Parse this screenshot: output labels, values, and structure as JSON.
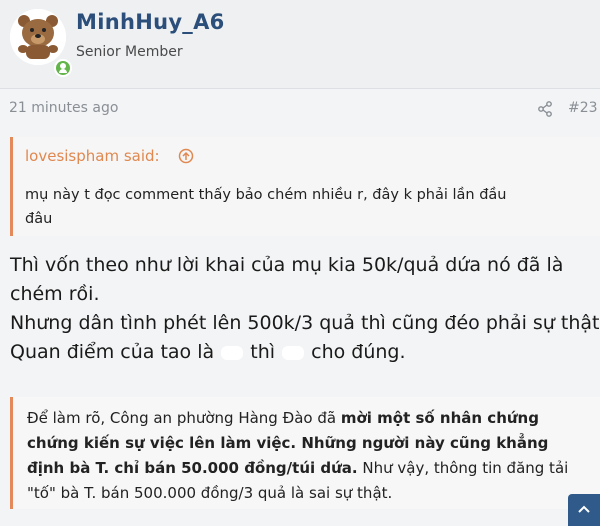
{
  "post": {
    "author": {
      "username": "MinhHuy_A6",
      "title": "Senior Member",
      "avatar_icon": "bear-avatar-icon",
      "online_icon": "online-status-icon"
    },
    "time": "21 minutes ago",
    "share_icon": "share-icon",
    "number": "#23",
    "quote": {
      "author_label": "lovesispham said:",
      "jump_icon": "arrow-up-circle-icon",
      "lines": [
        "mụ này t đọc comment thấy bảo chém nhiều r, đây k phải lần đầu",
        "đâu"
      ]
    },
    "body": {
      "line1": "Thì vốn theo như lời khai của mụ kia 50k/quả dứa nó đã là",
      "line2": "chém rồi.",
      "line3": "Nhưng dân tình phét lên 500k/3 quả thì cũng đéo phải sự thật.",
      "line4_a": "Quan điểm của tao là",
      "line4_b": "thì",
      "line4_c": "cho đúng."
    },
    "callout": {
      "p1": "Để làm rõ, Công an phường Hàng Đào đã ",
      "bold1": "mời một số nhân chứng chứng kiến sự việc lên làm việc. Những người này cũng khẳng định bà T. chỉ bán 50.000 đồng/túi dứa.",
      "p2": " Như vậy, thông tin đăng tải \"tố\" bà T. bán 500.000 đồng/3 quả là sai sự thật."
    },
    "scroll_top_icon": "arrow-up-icon"
  },
  "colors": {
    "username": "#2b4f7a",
    "quote_accent": "#e48a5a",
    "online": "#63b44a",
    "scroll_button": "#2f5a8a"
  }
}
